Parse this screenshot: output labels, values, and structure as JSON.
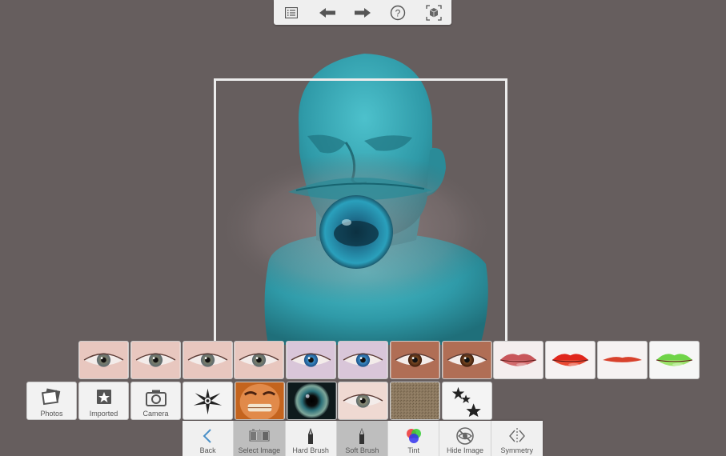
{
  "top_toolbar": {
    "icons": [
      "list-icon",
      "undo-arrow-icon",
      "redo-arrow-icon",
      "help-icon",
      "fit-view-icon"
    ]
  },
  "colors": {
    "background": "#665e5e",
    "toolbar": "#f0f0f0",
    "model_teal": "#2f9aa8",
    "active_tool": "#bebebe"
  },
  "image_library": {
    "row1": [
      "eye",
      "eye",
      "eye",
      "eye",
      "eye-blue",
      "eye-blue",
      "eye-brown",
      "eye-brown",
      "lips",
      "lips-red",
      "lips-thin",
      "lips-green"
    ],
    "sources": [
      {
        "label": "Photos",
        "icon": "photos-icon"
      },
      {
        "label": "Imported",
        "icon": "star-box-icon"
      },
      {
        "label": "Camera",
        "icon": "camera-icon"
      }
    ],
    "row2": [
      "tribal",
      "face",
      "iris",
      "eye-light",
      "texture",
      "stars"
    ]
  },
  "actions": [
    {
      "label": "Back",
      "icon": "back-chevron-icon",
      "active": false
    },
    {
      "label": "Select Image",
      "icon": "image-strip-icon",
      "active": true
    },
    {
      "label": "Hard Brush",
      "icon": "hard-brush-icon",
      "active": false
    },
    {
      "label": "Soft Brush",
      "icon": "soft-brush-icon",
      "active": true
    },
    {
      "label": "Tint",
      "icon": "tint-icon",
      "active": false
    },
    {
      "label": "Hide Image",
      "icon": "hide-eye-icon",
      "active": false
    },
    {
      "label": "Symmetry",
      "icon": "symmetry-icon",
      "active": false
    }
  ]
}
